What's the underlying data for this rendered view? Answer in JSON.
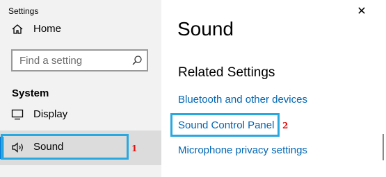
{
  "window": {
    "title": "Settings",
    "close_glyph": "✕"
  },
  "sidebar": {
    "home_label": "Home",
    "search_placeholder": "Find a setting",
    "section_heading": "System",
    "items": [
      {
        "label": "Display",
        "icon": "monitor-icon"
      },
      {
        "label": "Sound",
        "icon": "speaker-icon",
        "selected": true
      }
    ]
  },
  "main": {
    "title": "Sound",
    "related_heading": "Related Settings",
    "links": [
      "Bluetooth and other devices",
      "Sound Control Panel",
      "Microphone privacy settings"
    ]
  },
  "annotations": {
    "marker_1": "1",
    "marker_2": "2"
  },
  "colors": {
    "accent": "#0078d7",
    "link": "#0066b4",
    "callout": "#29a8e0",
    "marker": "#e01010"
  }
}
